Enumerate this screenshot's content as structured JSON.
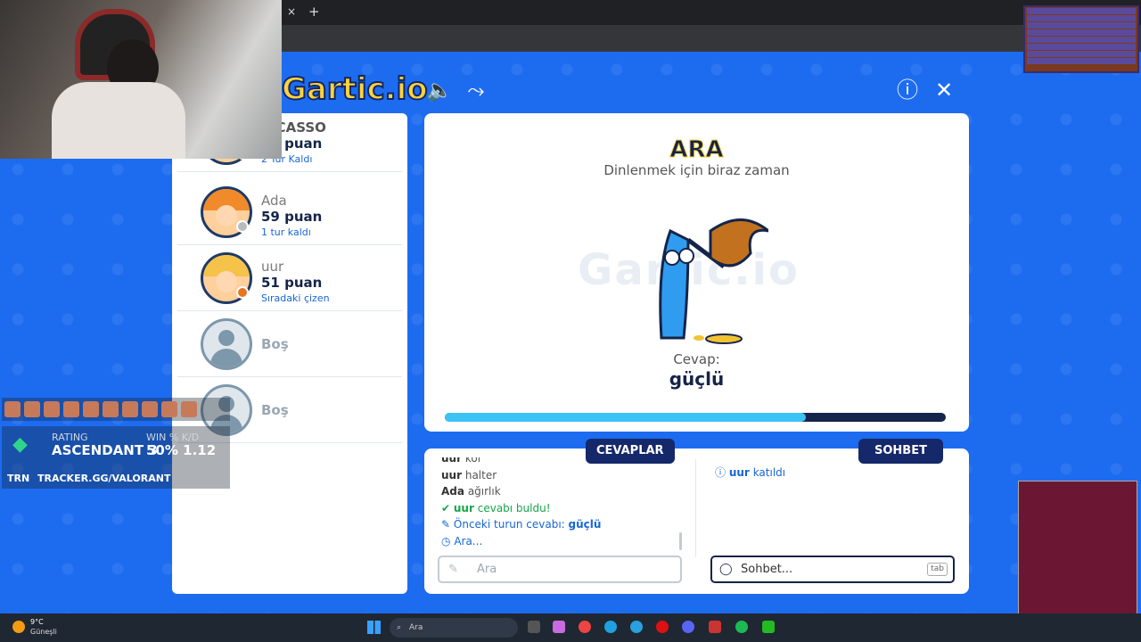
{
  "browser": {
    "tab_close": "×",
    "tab_new": "+"
  },
  "game": {
    "logo": "Gartic.io",
    "icons": {
      "sound": "🔈",
      "share": "⤳",
      "info": "ⓘ",
      "close": "✕"
    },
    "players": [
      {
        "name": "PICASSO",
        "score": "67 puan",
        "note": "2 Tur Kaldı"
      },
      {
        "name": "Ada",
        "score": "59 puan",
        "note": "1 tur kaldı"
      },
      {
        "name": "uur",
        "score": "51 puan",
        "note": "Sıradaki çizen"
      },
      {
        "name": "Boş"
      },
      {
        "name": "Boş"
      }
    ],
    "card": {
      "title": "ARA",
      "subtitle": "Dinlenmek için biraz zaman",
      "watermark": "Gartic.io",
      "answer_label": "Cevap:",
      "answer_word": "güçlü",
      "progress": 0.72
    },
    "answers": {
      "tab_label": "CEVAPLAR",
      "log": [
        {
          "user": "uur",
          "text": "kol"
        },
        {
          "user": "uur",
          "text": "halter"
        },
        {
          "user": "Ada",
          "text": "ağırlık"
        }
      ],
      "found": {
        "user": "uur",
        "text": "cevabı buldu!"
      },
      "prev_prefix": "Önceki turun cevabı:",
      "prev_answer": "güçlü",
      "waiting": "Ara...",
      "input_placeholder": "Ara"
    },
    "chat": {
      "tab_label": "SOHBET",
      "joined_user": "uur",
      "joined_text": "katıldı",
      "input_placeholder": "Sohbet...",
      "tab_hint": "tab"
    }
  },
  "overlay": {
    "rank": {
      "rating_label": "RATING",
      "rating_value": "ASCENDANT 3",
      "win_label": "WIN % K/D",
      "win_value": "50% 1.12"
    },
    "trn": {
      "logo": "TRN",
      "url": "TRACKER.GG/VALORANT"
    }
  },
  "taskbar": {
    "weather_temp": "9°C",
    "weather_desc": "Güneşli",
    "search_placeholder": "Ara"
  }
}
